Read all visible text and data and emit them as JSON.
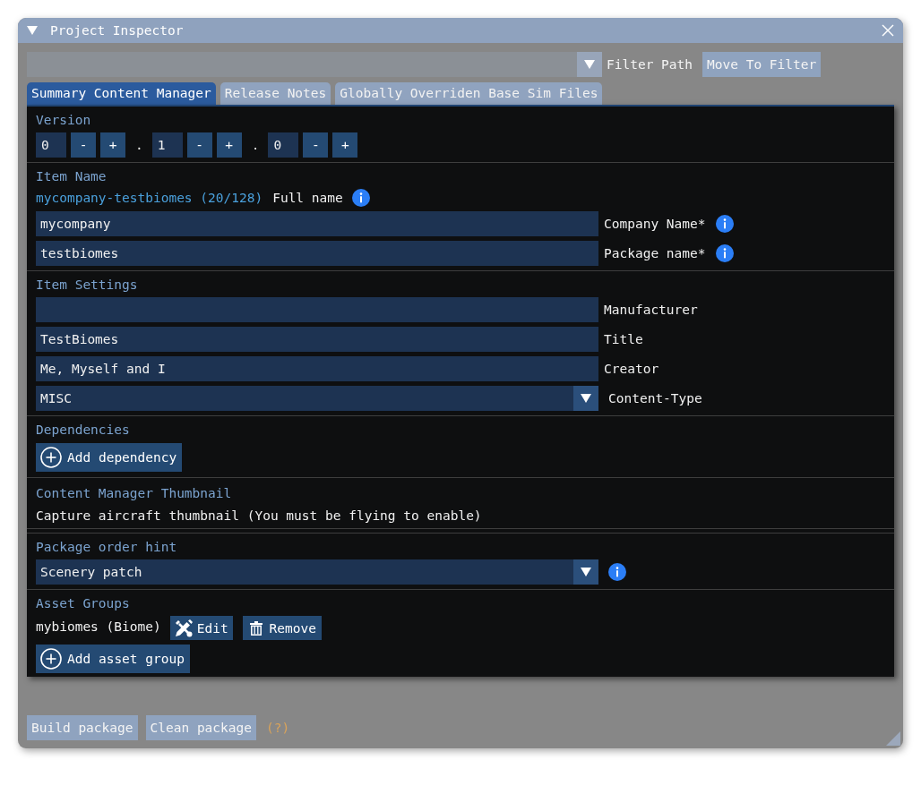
{
  "window": {
    "title": "Project Inspector"
  },
  "filter": {
    "label": "Filter Path",
    "button": "Move To Filter"
  },
  "tabs": [
    {
      "label": "Summary Content Manager",
      "selected": true
    },
    {
      "label": "Release Notes",
      "selected": false
    },
    {
      "label": "Globally Overriden Base Sim Files",
      "selected": false
    }
  ],
  "version": {
    "heading": "Version",
    "parts": [
      {
        "value": "0",
        "decrement": "-",
        "increment": "+"
      },
      {
        "value": "1",
        "decrement": "-",
        "increment": "+"
      },
      {
        "value": "0",
        "decrement": "-",
        "increment": "+"
      }
    ],
    "separators": [
      ".",
      "."
    ]
  },
  "item_name": {
    "heading": "Item Name",
    "full_name": "mycompany-testbiomes (20/128)",
    "full_name_label": "Full name",
    "full_name_info": true,
    "fields": [
      {
        "value": "mycompany",
        "label": "Company Name*",
        "info": true
      },
      {
        "value": "testbiomes",
        "label": "Package name*",
        "info": true
      }
    ]
  },
  "item_settings": {
    "heading": "Item Settings",
    "fields": [
      {
        "kind": "text",
        "label": "Manufacturer"
      },
      {
        "kind": "text",
        "value": "TestBiomes",
        "label": "Title"
      },
      {
        "kind": "text",
        "value": "Me, Myself and I",
        "label": "Creator"
      },
      {
        "kind": "dropdown",
        "value": "MISC",
        "label": "Content-Type"
      }
    ]
  },
  "dependencies": {
    "heading": "Dependencies",
    "button": "Add dependency"
  },
  "thumbnail": {
    "heading": "Content Manager Thumbnail",
    "text": "Capture aircraft thumbnail (You must be flying to enable)"
  },
  "package_order": {
    "heading": "Package order hint",
    "value": "Scenery patch",
    "info": true
  },
  "asset_groups": {
    "heading": "Asset Groups",
    "groups": [
      {
        "name": "mybiomes (Biome)",
        "edit": "Edit",
        "remove": "Remove"
      }
    ],
    "button": "Add asset group"
  },
  "footer": {
    "buttons": [
      "Build package",
      "Clean package"
    ],
    "help": "(?)"
  }
}
